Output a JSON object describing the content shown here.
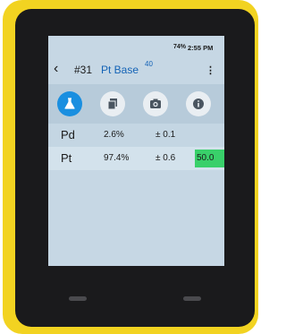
{
  "status": {
    "battery": "74%",
    "time": "2:55 PM"
  },
  "header": {
    "back_glyph": "‹",
    "sample_number": "#31",
    "sample_name": "Pt Base",
    "sample_superscript": "40",
    "menu_glyph": "⋮"
  },
  "toolbar": {
    "icons": [
      "flask-icon",
      "copy-icon",
      "camera-icon",
      "info-icon"
    ],
    "active_color": "#1a8fe0"
  },
  "results": [
    {
      "element": "Pd",
      "concentration": "2.6%",
      "error": "± 0.1"
    },
    {
      "element": "Pt",
      "concentration": "97.4%",
      "error": "± 0.6",
      "extra": "50.0"
    }
  ],
  "colors": {
    "device": "#f2d321",
    "screen": "#c6d7e4",
    "highlight": "#39d06a"
  }
}
